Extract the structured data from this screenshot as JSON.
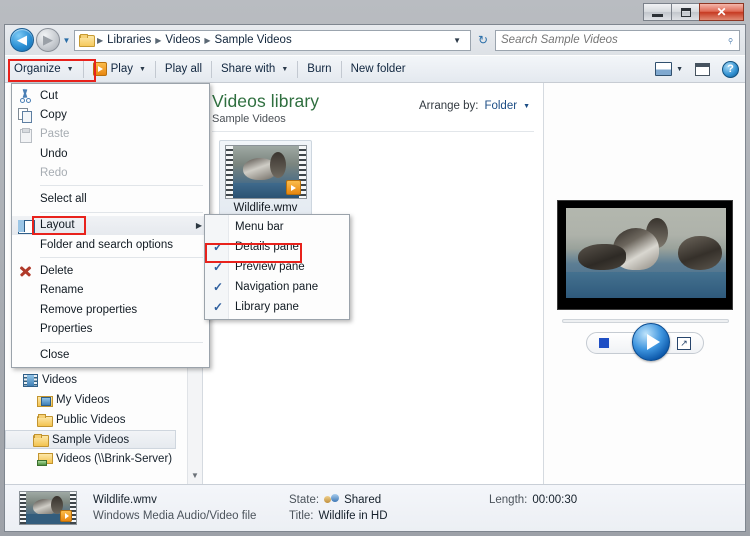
{
  "window": {
    "controls": {
      "minimize": "Minimize",
      "maximize": "Maximize",
      "close": "✕"
    }
  },
  "address": {
    "back_label": "◀",
    "forward_label": "▶",
    "history_caret": "▼",
    "folder_icon": "folder-icon",
    "crumbs": [
      "Libraries",
      "Videos",
      "Sample Videos"
    ],
    "separator": "▶",
    "dropdown_caret": "▼",
    "refresh_label": "↻"
  },
  "search": {
    "placeholder": "Search Sample Videos",
    "value": "",
    "icon": "magnifier-icon"
  },
  "toolbar": {
    "organize": "Organize",
    "play": "Play",
    "play_all": "Play all",
    "share_with": "Share with",
    "burn": "Burn",
    "new_folder": "New folder",
    "caret": "▼",
    "change_view_icon": "change-view-icon",
    "show_preview_icon": "show-preview-pane-icon",
    "help_icon": "?"
  },
  "organize_menu": {
    "items": [
      {
        "label": "Cut",
        "icon": "cut-icon",
        "disabled": false,
        "sep_after": false
      },
      {
        "label": "Copy",
        "icon": "copy-icon",
        "disabled": false,
        "sep_after": false
      },
      {
        "label": "Paste",
        "icon": "paste-icon",
        "disabled": true,
        "sep_after": false
      },
      {
        "label": "Undo",
        "icon": "",
        "disabled": false,
        "sep_after": false
      },
      {
        "label": "Redo",
        "icon": "",
        "disabled": true,
        "sep_after": true
      },
      {
        "label": "Select all",
        "icon": "",
        "disabled": false,
        "sep_after": true
      },
      {
        "label": "Layout",
        "icon": "layout-icon",
        "disabled": false,
        "submenu": true,
        "sep_after": false
      },
      {
        "label": "Folder and search options",
        "icon": "",
        "disabled": false,
        "sep_after": true
      },
      {
        "label": "Delete",
        "icon": "delete-icon",
        "disabled": false,
        "sep_after": false
      },
      {
        "label": "Rename",
        "icon": "",
        "disabled": false,
        "sep_after": false
      },
      {
        "label": "Remove properties",
        "icon": "",
        "disabled": false,
        "sep_after": false
      },
      {
        "label": "Properties",
        "icon": "",
        "disabled": false,
        "sep_after": true
      },
      {
        "label": "Close",
        "icon": "",
        "disabled": false,
        "sep_after": false
      }
    ],
    "submenu_arrow": "▶"
  },
  "layout_submenu": {
    "checkmark": "✓",
    "items": [
      {
        "label": "Menu bar",
        "checked": false
      },
      {
        "label": "Details pane",
        "checked": true
      },
      {
        "label": "Preview pane",
        "checked": true
      },
      {
        "label": "Navigation pane",
        "checked": true
      },
      {
        "label": "Library pane",
        "checked": true
      }
    ]
  },
  "nav_pane": {
    "items": [
      {
        "label": "Videos",
        "icon": "video-library-icon",
        "indent": 0,
        "selected": false
      },
      {
        "label": "My Videos",
        "icon": "video-folder-icon",
        "indent": 1,
        "selected": false
      },
      {
        "label": "Public Videos",
        "icon": "folder-icon",
        "indent": 1,
        "selected": false
      },
      {
        "label": "Sample Videos",
        "icon": "folder-icon",
        "indent": 2,
        "selected": true
      },
      {
        "label": "Videos (\\\\Brink-Server)",
        "icon": "network-folder-icon",
        "indent": 1,
        "selected": false
      }
    ],
    "scroll_down_arrow": "▼"
  },
  "library": {
    "title": "Videos library",
    "subtitle": "Sample Videos",
    "arrange_by_label": "Arrange by:",
    "arrange_by_value": "Folder",
    "arrange_caret": "▼",
    "files": [
      {
        "name": "Wildlife.wmv",
        "icon": "video-file-thumbnail",
        "selected": true
      }
    ]
  },
  "preview": {
    "media_title": "Wildlife.wmv preview",
    "stop_label": "Stop",
    "play_label": "Play",
    "fullscreen_label": "↗"
  },
  "details": {
    "file_name": "Wildlife.wmv",
    "file_type": "Windows Media Audio/Video file",
    "state_label": "State:",
    "state_value": "Shared",
    "title_label": "Title:",
    "title_value": "Wildlife in HD",
    "length_label": "Length:",
    "length_value": "00:00:30"
  },
  "highlights": {
    "organize_color": "#e8221c",
    "layout_color": "#e8221c",
    "details_pane_color": "#e8221c"
  }
}
